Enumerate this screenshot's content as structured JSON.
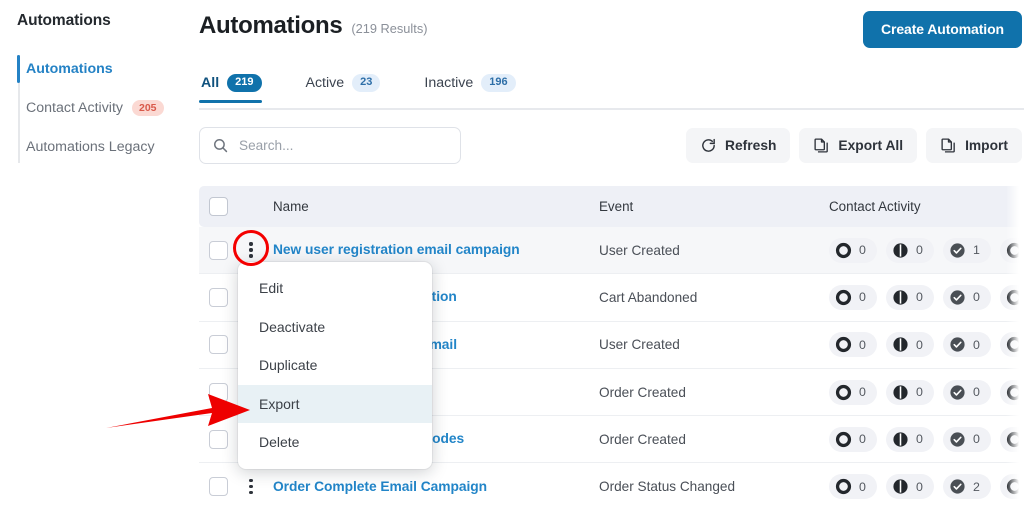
{
  "sidebar": {
    "title": "Automations",
    "items": [
      {
        "label": "Automations",
        "badge": ""
      },
      {
        "label": "Contact Activity",
        "badge": "205"
      },
      {
        "label": "Automations Legacy",
        "badge": ""
      }
    ]
  },
  "header": {
    "title": "Automations",
    "results": "(219 Results)",
    "create_label": "Create Automation",
    "accent_color": "#1072ab"
  },
  "tabs": [
    {
      "label": "All",
      "count": "219",
      "active": true
    },
    {
      "label": "Active",
      "count": "23",
      "active": false
    },
    {
      "label": "Inactive",
      "count": "196",
      "active": false
    }
  ],
  "toolbar": {
    "search_placeholder": "Search...",
    "search_value": "",
    "refresh_label": "Refresh",
    "export_all_label": "Export All",
    "import_label": "Import"
  },
  "table": {
    "columns": [
      "Name",
      "Event",
      "Contact Activity"
    ],
    "rows": [
      {
        "name": "New user registration email campaign",
        "event": "User Created",
        "activity": [
          "0",
          "0",
          "1"
        ]
      },
      {
        "name": "Cart Abandoned automation",
        "event": "Cart Abandoned",
        "activity": [
          "0",
          "0",
          "0"
        ]
      },
      {
        "name": "Welcome Registration Email",
        "event": "User Created",
        "activity": [
          "0",
          "0",
          "0"
        ]
      },
      {
        "name": "",
        "event": "Order Created",
        "activity": [
          "0",
          "0",
          "0"
        ]
      },
      {
        "name": "Send discount coupon codes",
        "event": "Order Created",
        "activity": [
          "0",
          "0",
          "0"
        ]
      },
      {
        "name": "Order Complete Email Campaign",
        "event": "Order Status Changed",
        "activity": [
          "0",
          "0",
          "2"
        ]
      }
    ]
  },
  "dropdown": {
    "items": [
      {
        "label": "Edit",
        "highlighted": false
      },
      {
        "label": "Deactivate",
        "highlighted": false
      },
      {
        "label": "Duplicate",
        "highlighted": false
      },
      {
        "label": "Export",
        "highlighted": true
      },
      {
        "label": "Delete",
        "highlighted": false
      }
    ]
  },
  "annotations": {
    "highlight_color": "#f40000",
    "arrow_color": "#ee0000"
  }
}
